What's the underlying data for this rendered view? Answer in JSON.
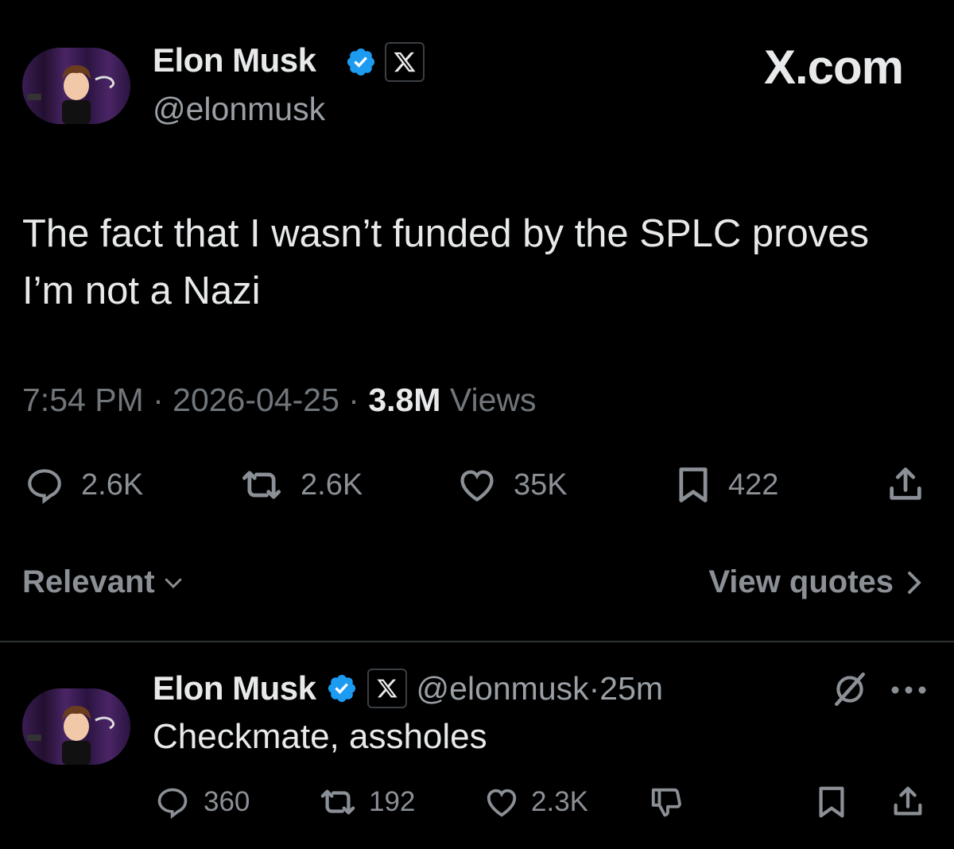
{
  "header": {
    "brand": "X.com"
  },
  "tweet": {
    "author_name": "Elon Musk",
    "author_handle": "@elonmusk",
    "text": "The fact that I wasn’t funded by the SPLC proves I’m not a Nazi",
    "time": "7:54 PM",
    "separator": " · ",
    "date": "2026-04-25",
    "views_count": "3.8M",
    "views_label": " Views",
    "actions": {
      "replies": "2.6K",
      "reposts": "2.6K",
      "likes": "35K",
      "bookmarks": "422"
    }
  },
  "controls": {
    "sort_label": "Relevant",
    "view_quotes_label": "View quotes"
  },
  "reply": {
    "author_name": "Elon Musk",
    "author_handle": "@elonmusk",
    "time": "25m",
    "separator": " · ",
    "text": "Checkmate, assholes",
    "actions": {
      "replies": "360",
      "reposts": "192",
      "likes": "2.3K"
    }
  },
  "colors": {
    "background": "#000000",
    "text_primary": "#e7e9ea",
    "text_secondary": "#71767b",
    "verified_blue": "#1d9bf0",
    "divider": "#2f3336"
  },
  "icons": [
    "avatar",
    "verified-badge-icon",
    "x-logo-icon",
    "reply-icon",
    "repost-icon",
    "like-icon",
    "bookmark-icon",
    "share-icon",
    "chevron-down-icon",
    "chevron-right-icon",
    "grok-icon",
    "more-icon",
    "dislike-icon"
  ]
}
